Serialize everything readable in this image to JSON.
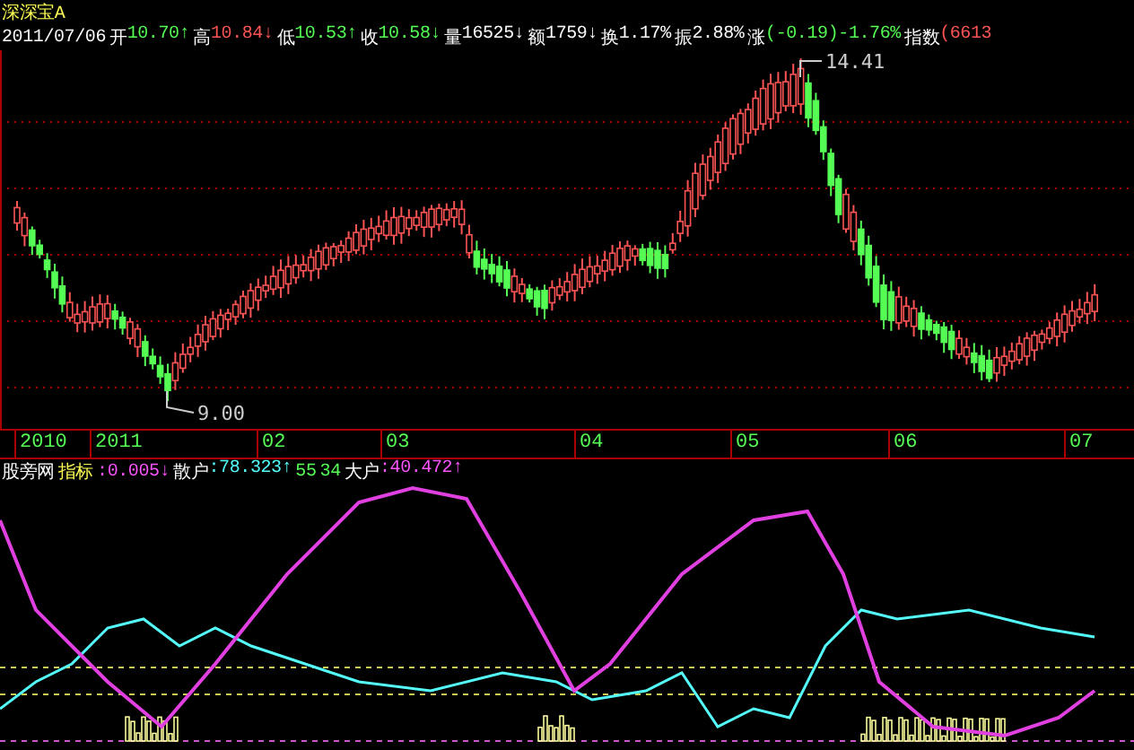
{
  "stock": {
    "name": "深深宝A",
    "date": "2011/07/06"
  },
  "quote": [
    {
      "label": "开",
      "value": "10.70",
      "arrow": "↑",
      "color": "#54fc54"
    },
    {
      "label": "高",
      "value": "10.84",
      "arrow": "↓",
      "color": "#fc5454"
    },
    {
      "label": "低",
      "value": "10.53",
      "arrow": "↑",
      "color": "#54fc54"
    },
    {
      "label": "收",
      "value": "10.58",
      "arrow": "↓",
      "color": "#54fc54"
    },
    {
      "label": "量",
      "value": "16525",
      "arrow": "↓",
      "color": "#fcfcfc"
    },
    {
      "label": "额",
      "value": "1759",
      "arrow": "↓",
      "color": "#fcfcfc"
    },
    {
      "label": "换",
      "value": "1.17%",
      "color": "#fcfcfc"
    },
    {
      "label": "振",
      "value": "2.88%",
      "color": "#fcfcfc"
    },
    {
      "label": "涨",
      "value": "(-0.19)-1.76%",
      "color": "#54fc54"
    },
    {
      "label": "指数",
      "value": "(6613",
      "color": "#fc5454"
    }
  ],
  "price_chart": {
    "high_label": "14.41",
    "low_label": "9.00"
  },
  "time_axis": [
    "2010",
    "2011",
    "02",
    "03",
    "04",
    "05",
    "06",
    "07"
  ],
  "indicator": {
    "name": "股旁网",
    "label": "指标",
    "values": [
      {
        "value": ":0.005",
        "arrow": "↓",
        "color": "#fc54fc"
      },
      {
        "label": "散户",
        "value": ":78.323",
        "arrow": "↑",
        "color": "#54fcfc"
      },
      {
        "value": "55",
        "color": "#54fc54"
      },
      {
        "value": "34",
        "color": "#54fc54"
      },
      {
        "label": "大户",
        "value": ":40.472",
        "arrow": "↑",
        "color": "#fc54fc"
      }
    ]
  }
}
